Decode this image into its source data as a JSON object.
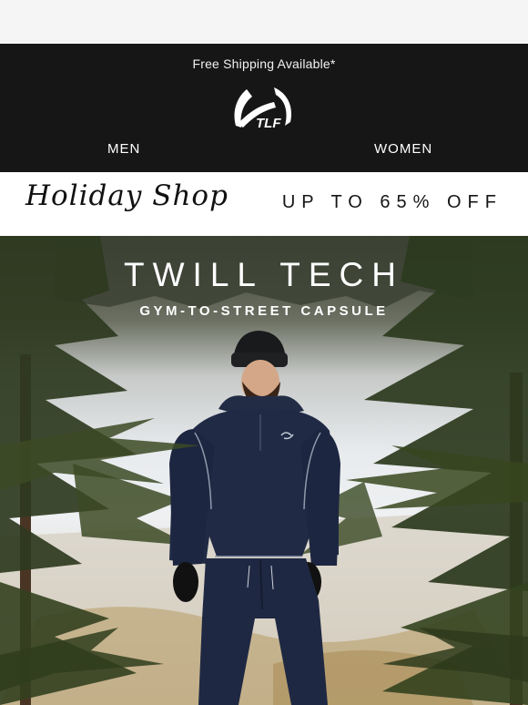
{
  "header": {
    "shipping_notice": "Free Shipping Available*",
    "logo_text": "TLF",
    "nav": {
      "men": "MEN",
      "women": "WOMEN"
    }
  },
  "promo": {
    "script_title": "Holiday Shop",
    "discount": "UP TO 65% OFF"
  },
  "hero": {
    "title": "TWILL TECH",
    "subtitle": "GYM-TO-STREET CAPSULE",
    "product_color": "#1f2a44"
  },
  "colors": {
    "header_bg": "#161616",
    "promo_bg": "#ffffff",
    "text_light": "#ffffff"
  }
}
